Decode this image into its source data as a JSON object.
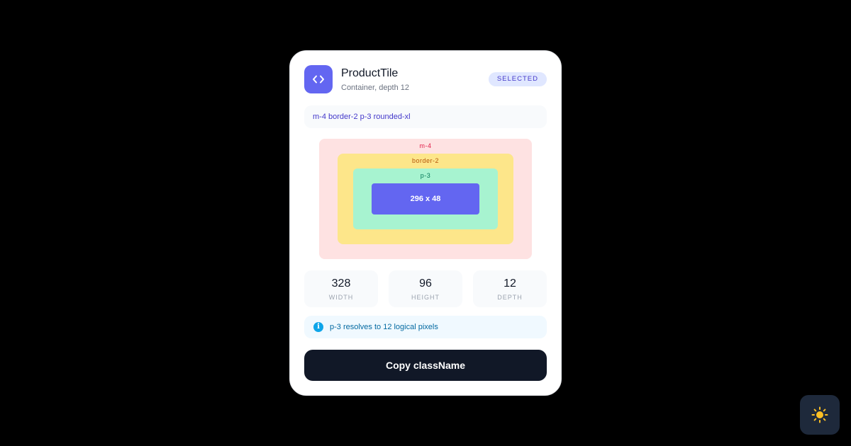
{
  "component": {
    "name": "ProductTile",
    "subtitle": "Container, depth 12",
    "badge": "SELECTED",
    "class_name": "m-4 border-2 p-3 rounded-xl"
  },
  "box_model": {
    "margin_label": "m-4",
    "border_label": "border-2",
    "padding_label": "p-3",
    "content_size": "296 x 48"
  },
  "stats": [
    {
      "value": "328",
      "label": "WIDTH"
    },
    {
      "value": "96",
      "label": "HEIGHT"
    },
    {
      "value": "12",
      "label": "DEPTH"
    }
  ],
  "note": {
    "icon": "info-icon",
    "text": "p-3 resolves to 12 logical pixels"
  },
  "actions": {
    "copy_label": "Copy className"
  },
  "icons": {
    "app": "code-brackets-icon",
    "theme_toggle": "sun-icon"
  },
  "colors": {
    "accent": "#6366f1",
    "margin": "#fee2e2",
    "border": "#fde68a",
    "padding": "#a7f3d0",
    "button": "#111827",
    "sun": "#fbbf24"
  }
}
